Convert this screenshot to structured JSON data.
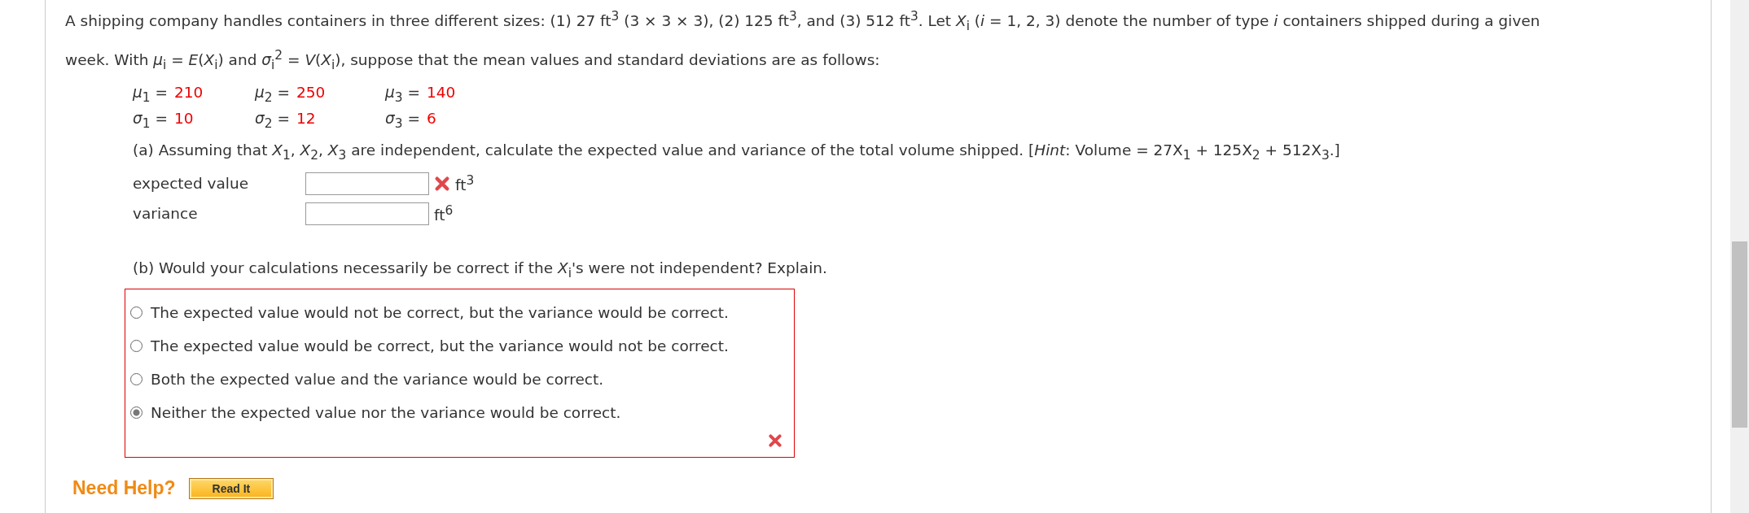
{
  "question": {
    "intro": "A shipping company handles containers in three different sizes: (1) 27 ft$^{3}$ (3 × 3 × 3), (2) 125 ft$^{3}$, and (3) 512 ft$^{3}$. Let *X*$_{i}$ (*i* = 1, 2, 3) denote the number of type *i* containers shipped during a given week. With *μ*$_{i}$ = *E*(*X*$_{i}$) and *σ*$_{i}$$^{2}$ = *V*(*X*$_{i}$), suppose that the mean values and standard deviations are as follows:",
    "parameter_rows": [
      [
        {
          "symbol": "*μ*$_{1}$ =",
          "value": "210"
        },
        {
          "symbol": "*μ*$_{2}$ =",
          "value": "250"
        },
        {
          "symbol": "*μ*$_{3}$ =",
          "value": "140"
        }
      ],
      [
        {
          "symbol": "*σ*$_{1}$ =",
          "value": "10"
        },
        {
          "symbol": "*σ*$_{2}$ =",
          "value": "12"
        },
        {
          "symbol": "*σ*$_{3}$ =",
          "value": "6"
        }
      ]
    ]
  },
  "part_a": {
    "prompt": "(a) Assuming that *X*$_{1}$, *X*$_{2}$, *X*$_{3}$ are independent, calculate the expected value and variance of the total volume shipped. [*Hint*: Volume = 27X$_{1}$ + 125X$_{2}$ + 512X$_{3}$.]",
    "fields": [
      {
        "label": "expected value",
        "marked_incorrect": true,
        "unit": "ft$^{3}$"
      },
      {
        "label": "variance",
        "marked_incorrect": false,
        "unit": "ft$^{6}$"
      }
    ]
  },
  "part_b": {
    "prompt": "(b) Would your calculations necessarily be correct if the *X*$_{i}$'s were not independent? Explain.",
    "marked_incorrect": true,
    "options": [
      {
        "label": "The expected value would not be correct, but the variance would be correct.",
        "selected": false
      },
      {
        "label": "The expected value would be correct, but the variance would not be correct.",
        "selected": false
      },
      {
        "label": "Both the expected value and the variance would be correct.",
        "selected": false
      },
      {
        "label": "Neither the expected value nor the variance would be correct.",
        "selected": true
      }
    ]
  },
  "help": {
    "title": "Need Help?",
    "buttons": [
      "Read It"
    ]
  }
}
